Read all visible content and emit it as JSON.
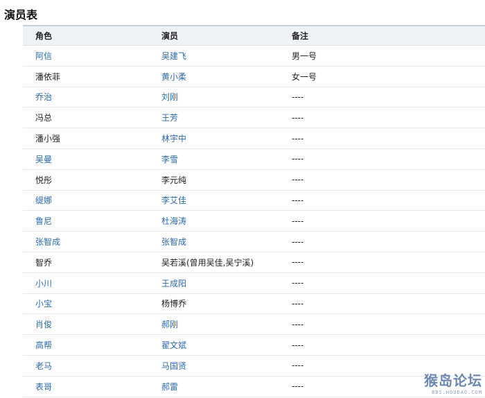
{
  "page_title": "演员表",
  "table": {
    "headers": [
      "角色",
      "演员",
      "备注"
    ],
    "rows": [
      {
        "role": "阿信",
        "role_link": true,
        "actor": "吴建飞",
        "actor_link": true,
        "note": "男一号"
      },
      {
        "role": "潘依菲",
        "role_link": false,
        "actor": "黄小柔",
        "actor_link": true,
        "note": "女一号"
      },
      {
        "role": "乔治",
        "role_link": true,
        "actor": "刘刚",
        "actor_link": true,
        "note": "----"
      },
      {
        "role": "冯总",
        "role_link": false,
        "actor": "王芳",
        "actor_link": true,
        "note": "----"
      },
      {
        "role": "潘小强",
        "role_link": false,
        "actor": "林宇中",
        "actor_link": true,
        "note": "----"
      },
      {
        "role": "吴曼",
        "role_link": true,
        "actor": "李雪",
        "actor_link": true,
        "note": "----"
      },
      {
        "role": "悦彤",
        "role_link": false,
        "actor": "李元纯",
        "actor_link": false,
        "note": "----"
      },
      {
        "role": "缇娜",
        "role_link": true,
        "actor": "李艾佳",
        "actor_link": true,
        "note": "----"
      },
      {
        "role": "鲁尼",
        "role_link": true,
        "actor": "杜海涛",
        "actor_link": true,
        "note": "----"
      },
      {
        "role": "张智成",
        "role_link": true,
        "actor": "张智成",
        "actor_link": true,
        "note": "----"
      },
      {
        "role": "智乔",
        "role_link": false,
        "actor": "吴若溪(曾用吴佳,吴宁溪)",
        "actor_link": false,
        "note": "----"
      },
      {
        "role": "小川",
        "role_link": true,
        "actor": "王成阳",
        "actor_link": true,
        "note": "----"
      },
      {
        "role": "小宝",
        "role_link": true,
        "actor": "杨博乔",
        "actor_link": false,
        "note": "----"
      },
      {
        "role": "肖俊",
        "role_link": true,
        "actor": "郝刚",
        "actor_link": true,
        "note": "----"
      },
      {
        "role": "高帮",
        "role_link": true,
        "actor": "翟文斌",
        "actor_link": true,
        "note": "----"
      },
      {
        "role": "老马",
        "role_link": true,
        "actor": "马国贤",
        "actor_link": true,
        "note": "----"
      },
      {
        "role": "表哥",
        "role_link": true,
        "actor": "郝雷",
        "actor_link": true,
        "note": "----"
      }
    ]
  },
  "watermark": {
    "main": "猴岛论坛",
    "sub": "BBS.HOUDAO.COM"
  },
  "colors": {
    "link": "#2b6aa8",
    "header_bg": "#eef2f6",
    "header_border": "#c6d1dc"
  }
}
